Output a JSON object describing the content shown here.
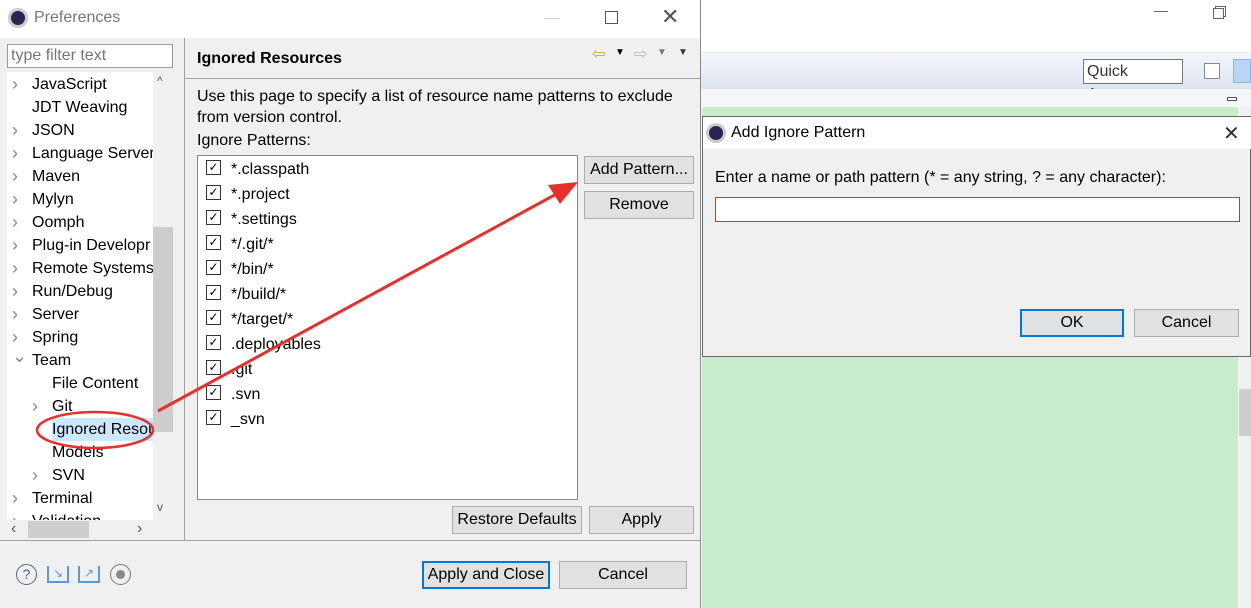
{
  "preferences": {
    "title": "Preferences",
    "filter_placeholder": "type filter text",
    "tree": [
      {
        "label": "JavaScript",
        "expandable": true,
        "level": 0
      },
      {
        "label": "JDT Weaving",
        "expandable": false,
        "level": 0
      },
      {
        "label": "JSON",
        "expandable": true,
        "level": 0
      },
      {
        "label": "Language Server",
        "expandable": true,
        "level": 0
      },
      {
        "label": "Maven",
        "expandable": true,
        "level": 0
      },
      {
        "label": "Mylyn",
        "expandable": true,
        "level": 0
      },
      {
        "label": "Oomph",
        "expandable": true,
        "level": 0
      },
      {
        "label": "Plug-in Developr",
        "expandable": true,
        "level": 0
      },
      {
        "label": "Remote Systems",
        "expandable": true,
        "level": 0
      },
      {
        "label": "Run/Debug",
        "expandable": true,
        "level": 0
      },
      {
        "label": "Server",
        "expandable": true,
        "level": 0
      },
      {
        "label": "Spring",
        "expandable": true,
        "level": 0
      },
      {
        "label": "Team",
        "expandable": true,
        "expanded": true,
        "level": 0
      },
      {
        "label": "File Content",
        "expandable": false,
        "level": 1
      },
      {
        "label": "Git",
        "expandable": true,
        "level": 1
      },
      {
        "label": "Ignored Resou",
        "expandable": false,
        "level": 1,
        "selected": true
      },
      {
        "label": "Models",
        "expandable": false,
        "level": 1
      },
      {
        "label": "SVN",
        "expandable": true,
        "level": 1
      },
      {
        "label": "Terminal",
        "expandable": true,
        "level": 0
      },
      {
        "label": "Validation",
        "expandable": true,
        "level": 0
      }
    ],
    "page_title": "Ignored Resources",
    "description": "Use this page to specify a list of resource name patterns to exclude from version control.",
    "patterns_label": "Ignore Patterns:",
    "patterns": [
      {
        "text": "*.classpath",
        "checked": true
      },
      {
        "text": "*.project",
        "checked": true
      },
      {
        "text": "*.settings",
        "checked": true
      },
      {
        "text": "*/.git/*",
        "checked": true
      },
      {
        "text": "*/bin/*",
        "checked": true
      },
      {
        "text": "*/build/*",
        "checked": true
      },
      {
        "text": "*/target/*",
        "checked": true
      },
      {
        "text": ".deployables",
        "checked": true
      },
      {
        "text": ".git",
        "checked": true
      },
      {
        "text": ".svn",
        "checked": true
      },
      {
        "text": "_svn",
        "checked": true
      }
    ],
    "add_pattern": "Add Pattern...",
    "remove": "Remove",
    "restore_defaults": "Restore Defaults",
    "apply": "Apply",
    "apply_and_close": "Apply and Close",
    "cancel": "Cancel"
  },
  "workbench": {
    "quick_access": "Quick Access",
    "editor_color": "#c8ebcb"
  },
  "dialog": {
    "title": "Add Ignore Pattern",
    "prompt": "Enter a name or path pattern (* = any string, ? = any character):",
    "value": "",
    "ok": "OK",
    "cancel": "Cancel"
  },
  "annotation": {
    "color": "#e8302a"
  }
}
